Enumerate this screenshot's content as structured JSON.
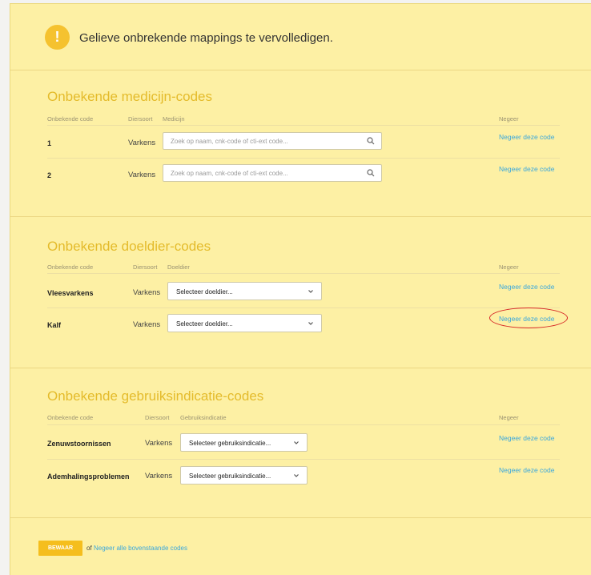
{
  "header": {
    "message": "Gelieve onbrekende mappings te vervolledigen.",
    "icon": "!"
  },
  "medicines": {
    "title": "Onbekende medicijn-codes",
    "columns": {
      "code": "Onbekende code",
      "species": "Diersoort",
      "item": "Medicijn",
      "ignore": "Negeer"
    },
    "rows": [
      {
        "code": "1",
        "species": "Varkens",
        "placeholder": "Zoek op naam, cnk-code of cti-ext code...",
        "ignore": "Negeer deze code"
      },
      {
        "code": "2",
        "species": "Varkens",
        "placeholder": "Zoek op naam, cnk-code of cti-ext code...",
        "ignore": "Negeer deze code"
      }
    ]
  },
  "targets": {
    "title": "Onbekende doeldier-codes",
    "columns": {
      "code": "Onbekende code",
      "species": "Diersoort",
      "item": "Doeldier",
      "ignore": "Negeer"
    },
    "rows": [
      {
        "code": "Vleesvarkens",
        "species": "Varkens",
        "select": "Selecteer doeldier...",
        "ignore": "Negeer deze code"
      },
      {
        "code": "Kalf",
        "species": "Varkens",
        "select": "Selecteer doeldier...",
        "ignore": "Negeer deze code"
      }
    ]
  },
  "indications": {
    "title": "Onbekende gebruiksindicatie-codes",
    "columns": {
      "code": "Onbekende code",
      "species": "Diersoort",
      "item": "Gebruiksindicatie",
      "ignore": "Negeer"
    },
    "rows": [
      {
        "code": "Zenuwstoornissen",
        "species": "Varkens",
        "select": "Selecteer gebruiksindicatie...",
        "ignore": "Negeer deze code"
      },
      {
        "code": "Ademhalingsproblemen",
        "species": "Varkens",
        "select": "Selecteer gebruiksindicatie...",
        "ignore": "Negeer deze code"
      }
    ]
  },
  "footer": {
    "save": "BEWAAR",
    "of": "of",
    "ignore_all": "Negeer alle bovenstaande codes"
  },
  "colors": {
    "panel": "#fdf0a4",
    "accent": "#f5be1d",
    "title": "#e4bb2b",
    "link": "#3aa7dc",
    "highlight": "#d62525"
  }
}
